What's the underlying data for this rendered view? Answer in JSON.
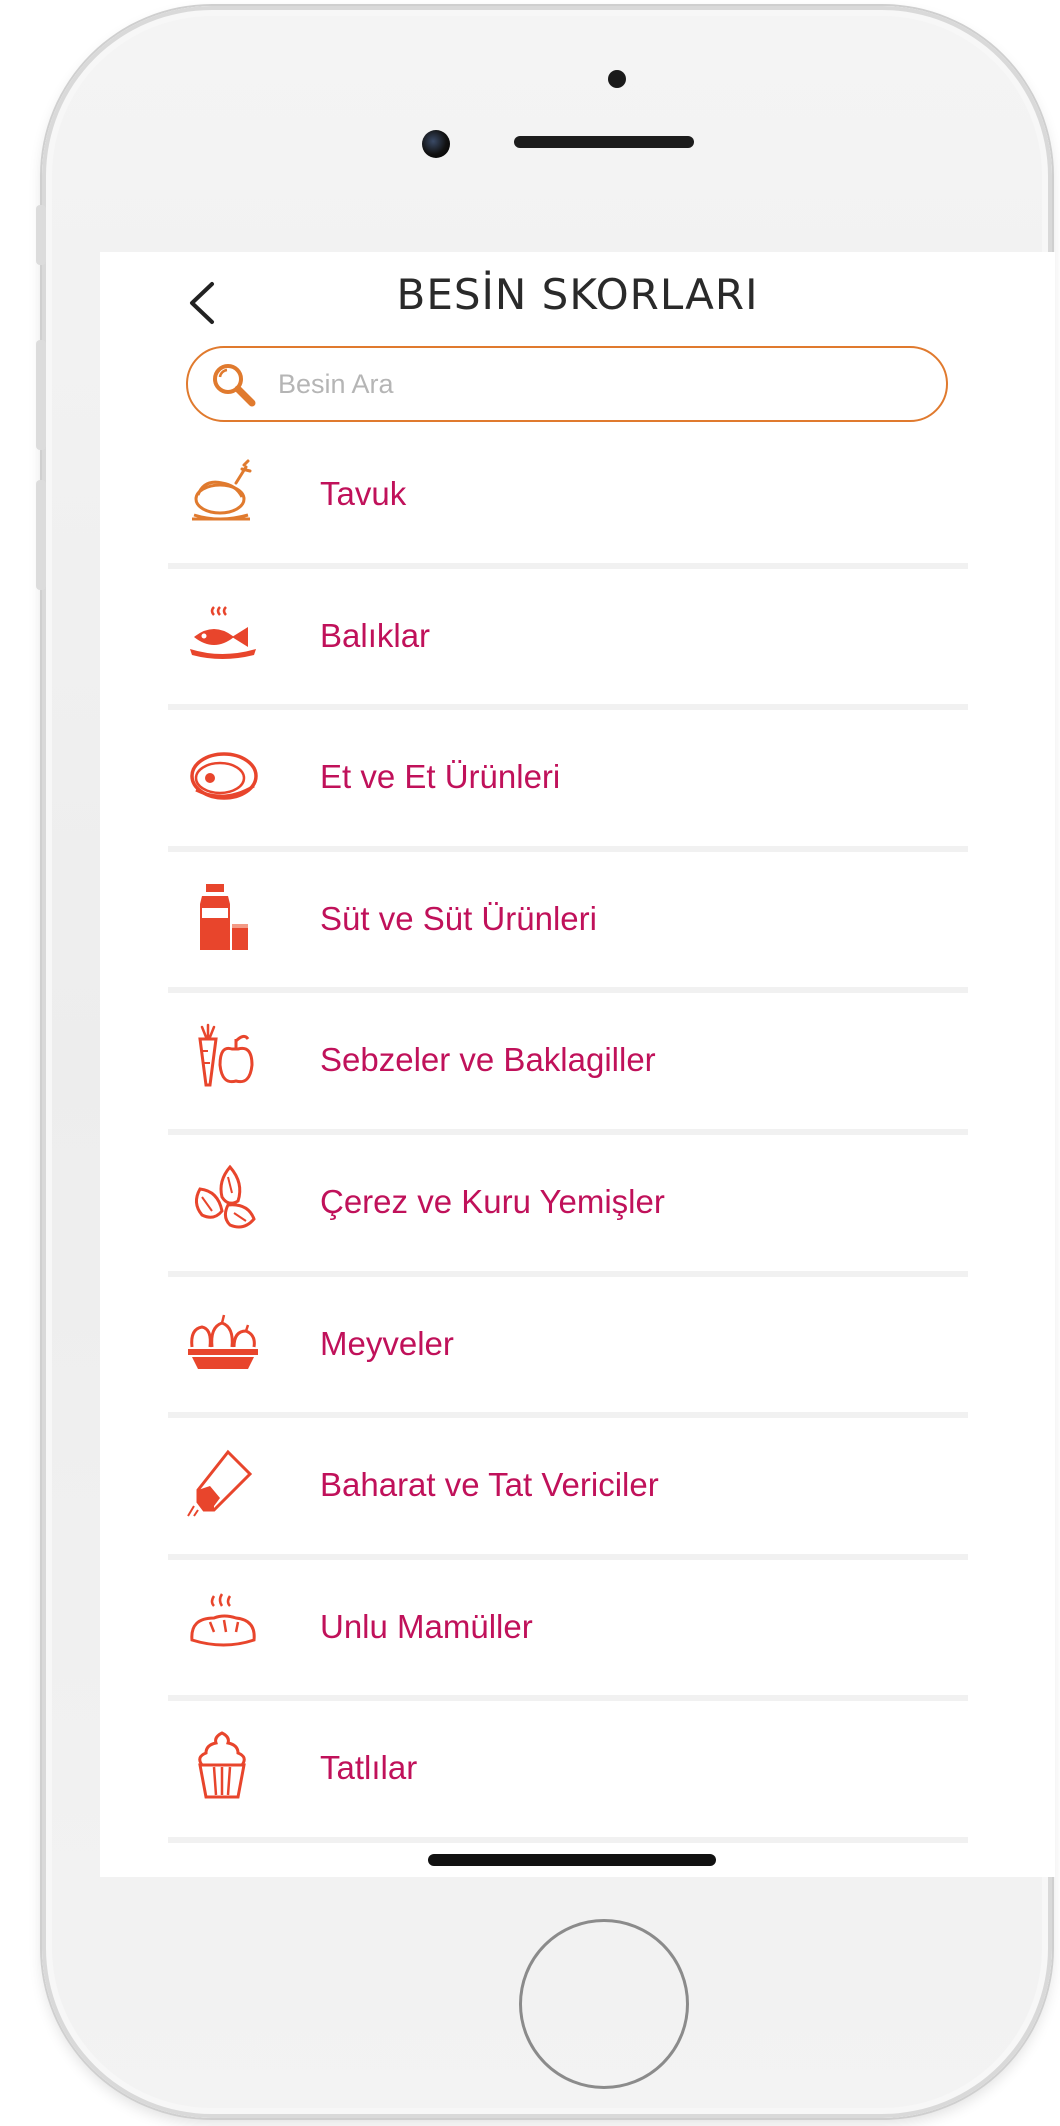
{
  "header": {
    "title": "BESİN SKORLARI",
    "back_icon": "chevron-left-icon"
  },
  "search": {
    "placeholder": "Besin Ara",
    "value": "",
    "icon": "search-icon"
  },
  "categories": [
    {
      "label": "Tavuk",
      "icon": "chicken-icon"
    },
    {
      "label": "Balıklar",
      "icon": "fish-icon"
    },
    {
      "label": "Et ve Et Ürünleri",
      "icon": "steak-icon"
    },
    {
      "label": "Süt ve Süt Ürünleri",
      "icon": "milk-icon"
    },
    {
      "label": "Sebzeler ve Baklagiller",
      "icon": "vegetables-icon"
    },
    {
      "label": "Çerez ve Kuru Yemişler",
      "icon": "nuts-icon"
    },
    {
      "label": "Meyveler",
      "icon": "fruit-basket-icon"
    },
    {
      "label": "Baharat ve Tat Vericiler",
      "icon": "spice-icon"
    },
    {
      "label": "Unlu Mamüller",
      "icon": "bread-icon"
    },
    {
      "label": "Tatlılar",
      "icon": "cupcake-icon"
    }
  ],
  "colors": {
    "accent_orange": "#e07a2e",
    "label_magenta": "#c0115a",
    "icon_red": "#e8452c",
    "divider": "#f1f1f1"
  }
}
